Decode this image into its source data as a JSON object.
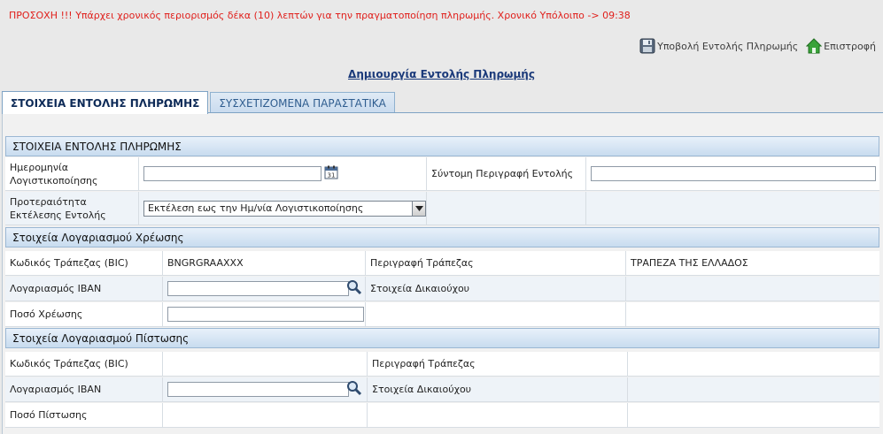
{
  "warning": "ΠΡΟΣΟΧΗ !!! Υπάρχει χρονικός περιορισμός δέκα (10) λεπτών για την πραγματοποίηση πληρωμής. Χρονικό Υπόλοιπο -> 09:38",
  "toolbar": {
    "submit_label": "Υποβολή Εντολής Πληρωμής",
    "back_label": "Επιστροφή"
  },
  "page_title": "Δημιουργία Εντολής Πληρωμής",
  "tabs": [
    {
      "label": "ΣΤΟΙΧΕΙΑ ΕΝΤΟΛΗΣ ΠΛΗΡΩΜΗΣ",
      "active": true
    },
    {
      "label": "ΣΥΣΧΕΤΙΖΟΜΕΝΑ ΠΑΡΑΣΤΑΤΙΚΑ",
      "active": false
    }
  ],
  "order": {
    "header": "ΣΤΟΙΧΕΙΑ ΕΝΤΟΛΗΣ ΠΛΗΡΩΜΗΣ",
    "date_label": "Ημερομηνία Λογιστικοποίησης",
    "date_value": "",
    "short_desc_label": "Σύντομη Περιγραφή Εντολής",
    "short_desc_value": "",
    "priority_label": "Προτεραιότητα Εκτέλεσης Εντολής",
    "priority_value": "Εκτέλεση εως την Ημ/νία Λογιστικοποίησης"
  },
  "debit": {
    "header": "Στοιχεία Λογαριασμού Χρέωσης",
    "bic_label": "Κωδικός Τράπεζας (BIC)",
    "bic_value": "BNGRGRAAXXX",
    "bank_desc_label": "Περιγραφή Τράπεζας",
    "bank_desc_value": "ΤΡΑΠΕΖΑ ΤΗΣ ΕΛΛΑΔΟΣ",
    "iban_label": "Λογαριασμός IBAN",
    "iban_value": "",
    "beneficiary_label": "Στοιχεία Δικαιούχου",
    "amount_label": "Ποσό Χρέωσης",
    "amount_value": ""
  },
  "credit": {
    "header": "Στοιχεία Λογαριασμού Πίστωσης",
    "bic_label": "Κωδικός Τράπεζας (BIC)",
    "bic_value": "",
    "bank_desc_label": "Περιγραφή Τράπεζας",
    "bank_desc_value": "",
    "iban_label": "Λογαριασμός IBAN",
    "iban_value": "",
    "beneficiary_label": "Στοιχεία Δικαιούχου",
    "amount_label": "Ποσό Πίστωσης"
  },
  "icons": {
    "submit": "floppy-disk-icon",
    "back": "home-icon",
    "calendar": "calendar-icon",
    "search": "magnifier-icon",
    "dropdown": "chevron-down-icon"
  }
}
